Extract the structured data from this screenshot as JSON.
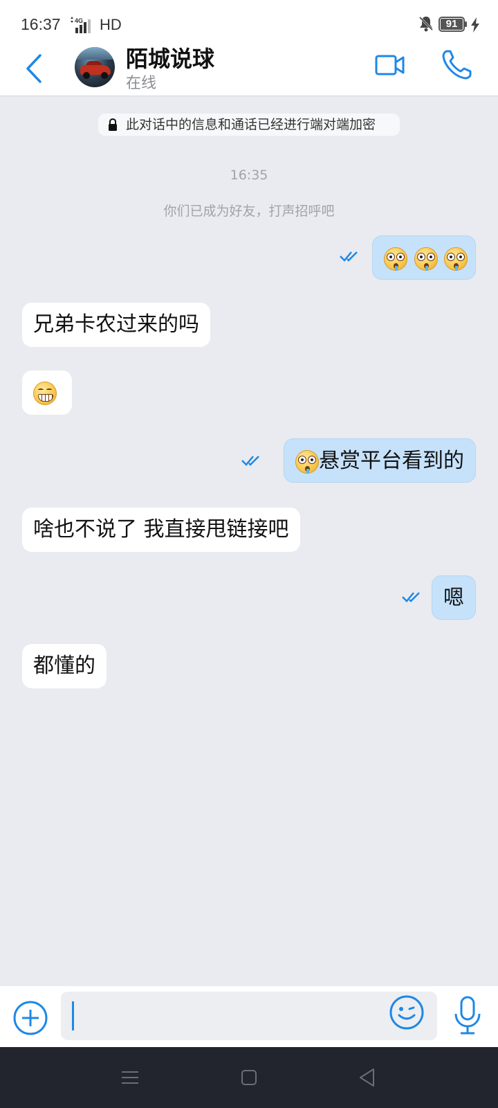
{
  "status_bar": {
    "time": "16:37",
    "network": "4G",
    "hd": "HD",
    "battery": "91",
    "icons": [
      "signal-icon",
      "mute-icon",
      "battery-icon",
      "charging-icon"
    ]
  },
  "header": {
    "contact_name": "陌城说球",
    "contact_status": "在线",
    "icons": [
      "back-icon",
      "video-call-icon",
      "phone-icon"
    ]
  },
  "chat": {
    "encryption_notice": "此对话中的信息和通话已经进行端对端加密",
    "time_divider": "16:35",
    "friend_notice": "你们已成为好友，打声招呼吧",
    "messages": [
      {
        "dir": "out",
        "text": "",
        "emoji": [
          "flushed",
          "flushed",
          "flushed"
        ],
        "read": true
      },
      {
        "dir": "in",
        "text": "兄弟卡农过来的吗"
      },
      {
        "dir": "in",
        "text": "",
        "emoji": [
          "grin"
        ]
      },
      {
        "dir": "out",
        "text": "悬赏平台看到的",
        "emoji": [
          "flushed"
        ],
        "read": true
      },
      {
        "dir": "in",
        "text": "啥也不说了 我直接甩链接吧"
      },
      {
        "dir": "out",
        "text": "嗯",
        "read": true
      },
      {
        "dir": "in",
        "text": "都懂的"
      }
    ]
  },
  "input_bar": {
    "placeholder": "",
    "icons": [
      "plus-icon",
      "emoji-icon",
      "microphone-icon"
    ]
  },
  "nav_bar": {
    "icons": [
      "menu-icon",
      "home-icon",
      "back-nav-icon"
    ]
  },
  "colors": {
    "accent": "#1e88e5",
    "outgoing_bubble": "#c6e2fb",
    "incoming_bubble": "#ffffff",
    "chat_background": "#e9ebf0",
    "nav_bar": "#22252d"
  }
}
